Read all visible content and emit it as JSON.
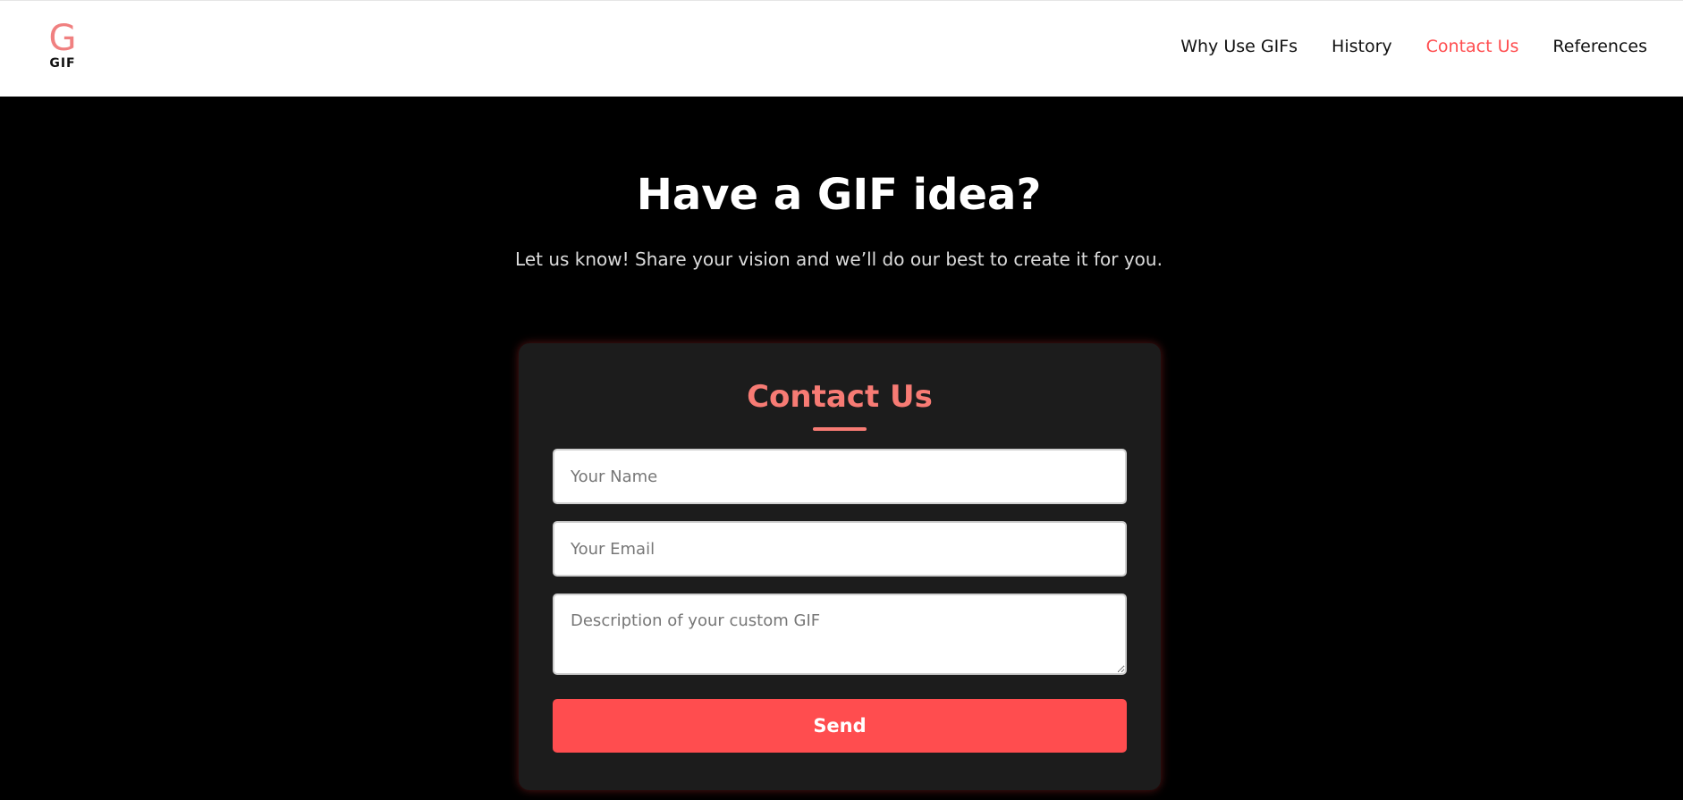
{
  "header": {
    "logo_letter": "G",
    "logo_text": "GIF",
    "nav": [
      {
        "label": "Why Use GIFs",
        "active": false
      },
      {
        "label": "History",
        "active": false
      },
      {
        "label": "Contact Us",
        "active": true
      },
      {
        "label": "References",
        "active": false
      }
    ]
  },
  "hero": {
    "title": "Have a GIF idea?",
    "subtitle": "Let us know! Share your vision and we’ll do our best to create it for you."
  },
  "contact_form": {
    "title": "Contact Us",
    "name_placeholder": "Your Name",
    "email_placeholder": "Your Email",
    "description_placeholder": "Description of your custom GIF",
    "name_value": "",
    "email_value": "",
    "description_value": "",
    "send_label": "Send"
  },
  "colors": {
    "accent": "#ff4d4f",
    "card_title": "#f77b74",
    "logo": "#f08080",
    "background": "#000000",
    "card_background": "#1c1c1c"
  }
}
